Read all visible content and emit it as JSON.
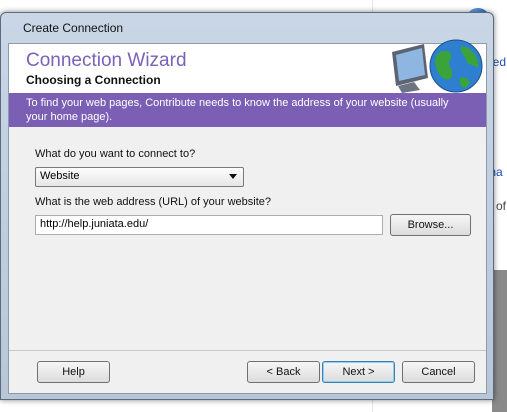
{
  "background": {
    "link1": "ned",
    "link2": "tha",
    "text3": "e of"
  },
  "dialog": {
    "title": "Create Connection",
    "header": {
      "title": "Connection Wizard",
      "subtitle": "Choosing a Connection"
    },
    "banner": "To find your web pages, Contribute needs to know the address of your website (usually your home page).",
    "connect_label": "What do you want to connect to?",
    "connect_value": "Website",
    "url_label": "What is the web address (URL) of your website?",
    "url_value": "http://help.juniata.edu/",
    "browse_label": "Browse...",
    "buttons": {
      "help": "Help",
      "back": "< Back",
      "next": "Next >",
      "cancel": "Cancel"
    }
  },
  "colors": {
    "accent_purple": "#7b5fb4",
    "header_title": "#7a62b8"
  },
  "icons": [
    "computer-monitor-icon",
    "globe-icon",
    "dropdown-arrow-icon"
  ]
}
